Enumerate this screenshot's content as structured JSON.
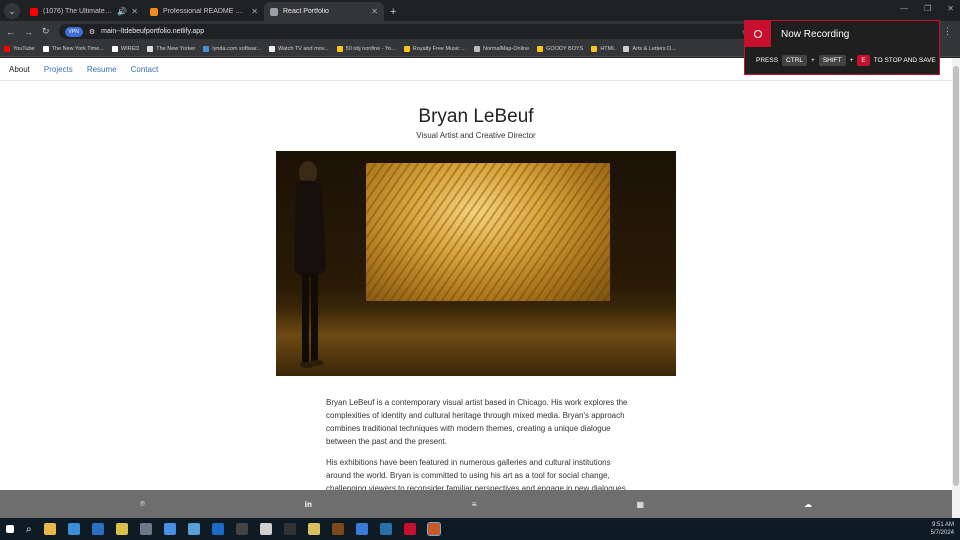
{
  "browser": {
    "tabs": [
      {
        "title": "(1076) The Ultimate PlayS...",
        "color": "#ff0000",
        "active": false
      },
      {
        "title": "Professional README Guide | T...",
        "color": "#f08c20",
        "active": false
      },
      {
        "title": "React Portfolio",
        "color": "#9aa0a6",
        "active": true
      }
    ],
    "new_tab": "+",
    "vpn_label": "VPN",
    "url": "main--ltdebeufportfolio.netlify.app",
    "bookmarks": [
      {
        "label": "YouTube",
        "color": "#ff0000"
      },
      {
        "label": "The New York Time...",
        "color": "#ffffff"
      },
      {
        "label": "WIRED",
        "color": "#ffffff"
      },
      {
        "label": "The New Yorker",
        "color": "#dddddd"
      },
      {
        "label": "lynda.com softwar...",
        "color": "#4a90d9"
      },
      {
        "label": "Watch TV and mov...",
        "color": "#eeeeee"
      },
      {
        "label": "50 obj nonfine - Yo...",
        "color": "#f5c518"
      },
      {
        "label": "Royalty Free Music ...",
        "color": "#f5c518"
      },
      {
        "label": "NormalMap-Online",
        "color": "#bbbbbb"
      },
      {
        "label": "GOODY BOYS",
        "color": "#f5c518"
      },
      {
        "label": "HTML",
        "color": "#f5c518"
      },
      {
        "label": "Arts & Letters D...",
        "color": "#cccccc"
      }
    ]
  },
  "recording": {
    "title": "Now Recording",
    "press": "PRESS",
    "key1": "CTRL",
    "plus": "+",
    "key2": "SHIFT",
    "key3": "E",
    "action": "TO STOP AND SAVE"
  },
  "nav": {
    "items": [
      "About",
      "Projects",
      "Resume",
      "Contact"
    ],
    "current": "About"
  },
  "hero": {
    "name": "Bryan LeBeuf",
    "subtitle": "Visual Artist and Creative Director"
  },
  "bio": {
    "p1": "Bryan LeBeuf is a contemporary visual artist based in Chicago. His work explores the complexities of identity and cultural heritage through mixed media. Bryan's approach combines traditional techniques with modern themes, creating a unique dialogue between the past and the present.",
    "p2": "His exhibitions have been featured in numerous galleries and cultural institutions around the world. Bryan is committed to using his art as a tool for social change, challenging viewers to reconsider familiar perspectives and engage in new dialogues."
  },
  "footer": {
    "icons": [
      "github-icon",
      "linkedin-icon",
      "stack-icon",
      "calendar-icon",
      "soundcloud-icon"
    ]
  },
  "taskbar": {
    "time": "9:51 AM",
    "date": "5/7/2024"
  },
  "colors": {
    "accent": "#3a6cb5",
    "record": "#c8102e",
    "footer": "#6e6e6e"
  }
}
